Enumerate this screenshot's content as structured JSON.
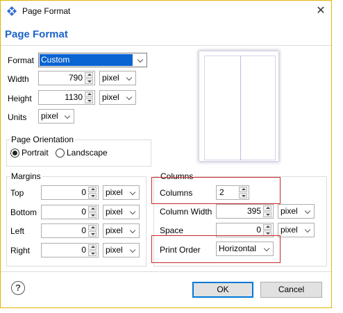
{
  "window": {
    "title": "Page Format",
    "close_glyph": "✕",
    "icon": "app-diamond-icon"
  },
  "heading": "Page Format",
  "format": {
    "label": "Format",
    "value": "Custom"
  },
  "width": {
    "label": "Width",
    "value": "790",
    "unit": "pixel"
  },
  "height": {
    "label": "Height",
    "value": "1130",
    "unit": "pixel"
  },
  "units": {
    "label": "Units",
    "value": "pixel"
  },
  "orientation": {
    "title": "Page Orientation",
    "options": [
      {
        "label": "Portrait",
        "selected": true
      },
      {
        "label": "Landscape",
        "selected": false
      }
    ]
  },
  "margins": {
    "title": "Margins",
    "rows": [
      {
        "label": "Top",
        "value": "0",
        "unit": "pixel"
      },
      {
        "label": "Bottom",
        "value": "0",
        "unit": "pixel"
      },
      {
        "label": "Left",
        "value": "0",
        "unit": "pixel"
      },
      {
        "label": "Right",
        "value": "0",
        "unit": "pixel"
      }
    ]
  },
  "columns": {
    "title": "Columns",
    "count": {
      "label": "Columns",
      "value": "2"
    },
    "column_width": {
      "label": "Column Width",
      "value": "395",
      "unit": "pixel"
    },
    "space": {
      "label": "Space",
      "value": "0",
      "unit": "pixel"
    },
    "print_order": {
      "label": "Print Order",
      "value": "Horizontal"
    }
  },
  "footer": {
    "help_glyph": "?",
    "ok_label": "OK",
    "cancel_label": "Cancel"
  },
  "colors": {
    "heading": "#1d63c6",
    "highlight": "#c62828",
    "selection": "#0a64d2"
  }
}
